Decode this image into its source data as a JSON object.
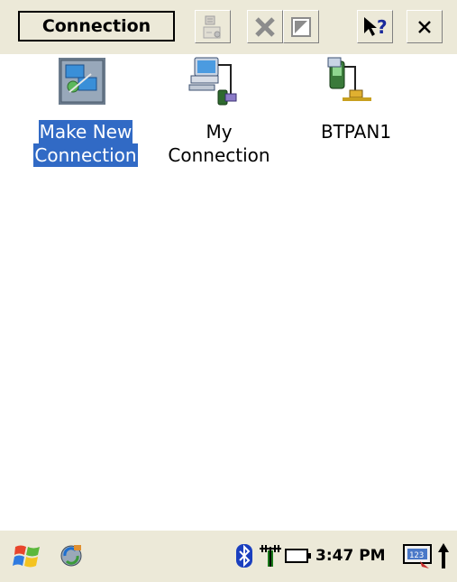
{
  "toolbar": {
    "title": "Connection",
    "buttons": [
      {
        "name": "properties-button",
        "icon": "properties-icon"
      },
      {
        "name": "delete-button",
        "icon": "delete-x-icon"
      },
      {
        "name": "view-button",
        "icon": "view-icon"
      },
      {
        "name": "help-button",
        "icon": "help-arrow-icon"
      },
      {
        "name": "close-button",
        "icon": "close-icon"
      }
    ]
  },
  "connections": [
    {
      "line1": "Make New",
      "line2": "Connection",
      "icon": "make-new-connection-icon",
      "selected": true
    },
    {
      "line1": "My",
      "line2": "Connection",
      "icon": "dialup-connection-icon",
      "selected": false
    },
    {
      "line1": "BTPAN1",
      "line2": "",
      "icon": "bluetooth-pan-connection-icon",
      "selected": false
    }
  ],
  "taskbar": {
    "clock": "3:47 PM",
    "items": [
      "start-windows-icon",
      "network-sync-icon",
      "bluetooth-icon",
      "signal-strength-icon",
      "battery-icon",
      "input-panel-icon",
      "up-arrow-icon"
    ]
  },
  "colors": {
    "chrome": "#ece9d8",
    "selection": "#316ac5"
  }
}
